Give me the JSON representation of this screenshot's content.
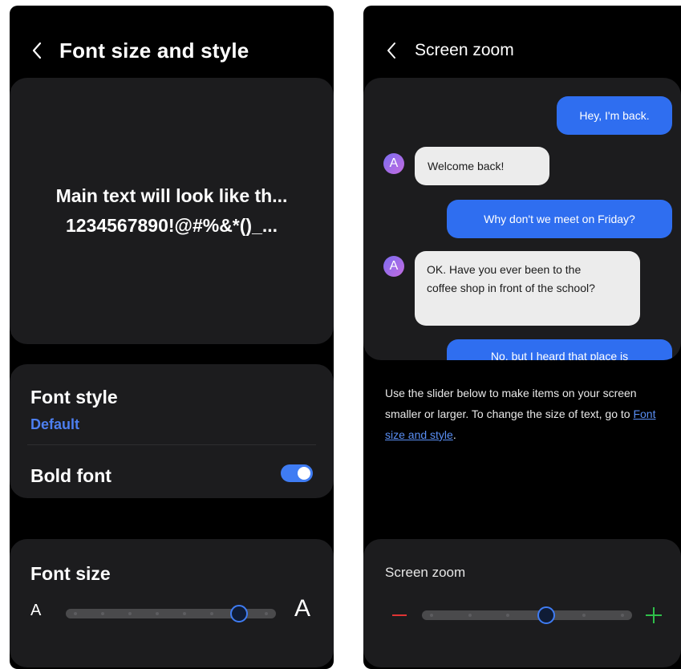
{
  "left_screen": {
    "title": "Font size and style",
    "preview": {
      "line1": "Main text will look like th...",
      "line2": "1234567890!@#%&*()_..."
    },
    "font_style": {
      "label": "Font style",
      "value": "Default"
    },
    "bold_font": {
      "label": "Bold font",
      "enabled": true
    },
    "font_size": {
      "label": "Font size",
      "small_glyph": "A",
      "large_glyph": "A",
      "level": 6,
      "steps": 8
    }
  },
  "right_screen": {
    "title": "Screen zoom",
    "messages": [
      {
        "from": "me",
        "text": "Hey, I'm back."
      },
      {
        "from": "other",
        "avatar": "A",
        "text": "Welcome back!"
      },
      {
        "from": "me",
        "text": "Why don't we meet on Friday?"
      },
      {
        "from": "other",
        "avatar": "A",
        "text": "OK. Have you ever been to the coffee shop in front of the school?"
      },
      {
        "from": "me",
        "text": "No, but I heard that place is"
      }
    ],
    "help": {
      "text_before": "Use the slider below to make items on your screen smaller or larger. To change the size of text, go to ",
      "link": "Font size and style",
      "text_after": "."
    },
    "zoom": {
      "label": "Screen zoom",
      "minus": "−",
      "plus": "+",
      "level": 3,
      "steps": 6
    }
  },
  "colors": {
    "accent": "#3f7cf3",
    "link": "#5a8ff5",
    "minus": "#e03434",
    "plus": "#2fbf4a",
    "card": "#1c1c1e"
  },
  "icons": {
    "back": "chevron-left-icon",
    "minus": "minus-icon",
    "plus": "plus-icon"
  }
}
